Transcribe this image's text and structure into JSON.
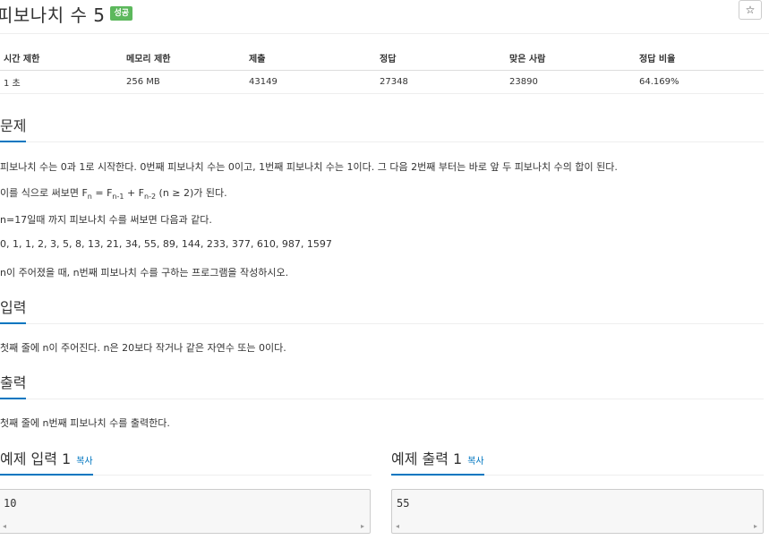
{
  "problem": {
    "title": "피보나치 수 5",
    "badge": "성공",
    "star_icon": "☆"
  },
  "stats": {
    "headers": [
      "시간 제한",
      "메모리 제한",
      "제출",
      "정답",
      "맞은 사람",
      "정답 비율"
    ],
    "values": [
      "1 초",
      "256 MB",
      "43149",
      "27348",
      "23890",
      "64.169%"
    ]
  },
  "sections": {
    "problem_heading": "문제",
    "problem_paragraphs": {
      "p1": "피보나치 수는 0과 1로 시작한다. 0번째 피보나치 수는 0이고, 1번째 피보나치 수는 1이다. 그 다음 2번째 부터는 바로 앞 두 피보나치 수의 합이 된다.",
      "p2_prefix": "이를 식으로 써보면 F",
      "p2_n": "n",
      "p2_eq": " = F",
      "p2_n1": "n-1",
      "p2_plus": " + F",
      "p2_n2": "n-2",
      "p2_suffix": " (n ≥ 2)가 된다.",
      "p3": "n=17일때 까지 피보나치 수를 써보면 다음과 같다.",
      "p4": "0, 1, 1, 2, 3, 5, 8, 13, 21, 34, 55, 89, 144, 233, 377, 610, 987, 1597",
      "p5": "n이 주어졌을 때, n번째 피보나치 수를 구하는 프로그램을 작성하시오."
    },
    "input_heading": "입력",
    "input_text": "첫째 줄에 n이 주어진다. n은 20보다 작거나 같은 자연수 또는 0이다.",
    "output_heading": "출력",
    "output_text": "첫째 줄에 n번째 피보나치 수를 출력한다."
  },
  "samples": {
    "input_title": "예제 입력 1",
    "output_title": "예제 출력 1",
    "copy_label": "복사",
    "input_value": "10",
    "output_value": "55",
    "scroll_left": "◂",
    "scroll_right": "▸"
  },
  "colors": {
    "accent": "#0076C0",
    "badge_success": "#5cb85c"
  }
}
